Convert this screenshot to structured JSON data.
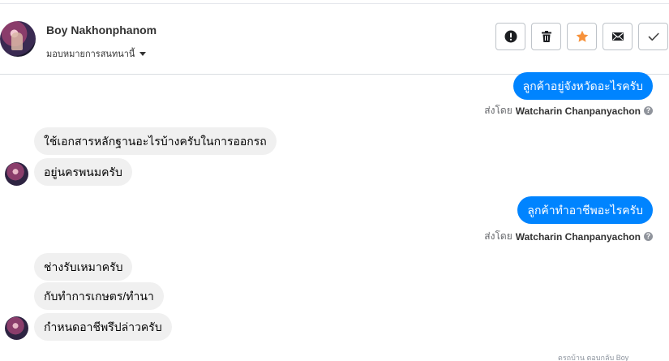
{
  "header": {
    "name": "Boy Nakhonphanom",
    "assign_label": "มอบหมายการสนทนานี้"
  },
  "actions": [
    {
      "icon": "alert-icon"
    },
    {
      "icon": "trash-icon"
    },
    {
      "icon": "star-icon",
      "color": "#f7923b"
    },
    {
      "icon": "mail-icon"
    },
    {
      "icon": "check-icon"
    }
  ],
  "colors": {
    "outgoing": "#0084ff",
    "incoming": "#f0f0f0",
    "star": "#f7923b"
  },
  "messages": {
    "m1": "ลูกค้าอยู่จังหวัดอะไรครับ",
    "m1_sent_prefix": "ส่งโดย",
    "m1_sender": "Watcharin Chanpanyachon",
    "m2": "ใช้เอกสารหลักฐานอะไรบ้างครับในการออกรถ",
    "m3": "อยู่นครพนมครับ",
    "m4": "ลูกค้าทำอาชีพอะไรครับ",
    "m4_sent_prefix": "ส่งโดย",
    "m4_sender": "Watcharin Chanpanyachon",
    "m5": "ช่างรับเหมาครับ",
    "m6": "กับทำการเกษตร/ทำนา",
    "m7": "กำหนดอาชีพรึปล่าวครับ"
  },
  "footnote": "ดรถบ้าน ตอบกลับ Boy"
}
